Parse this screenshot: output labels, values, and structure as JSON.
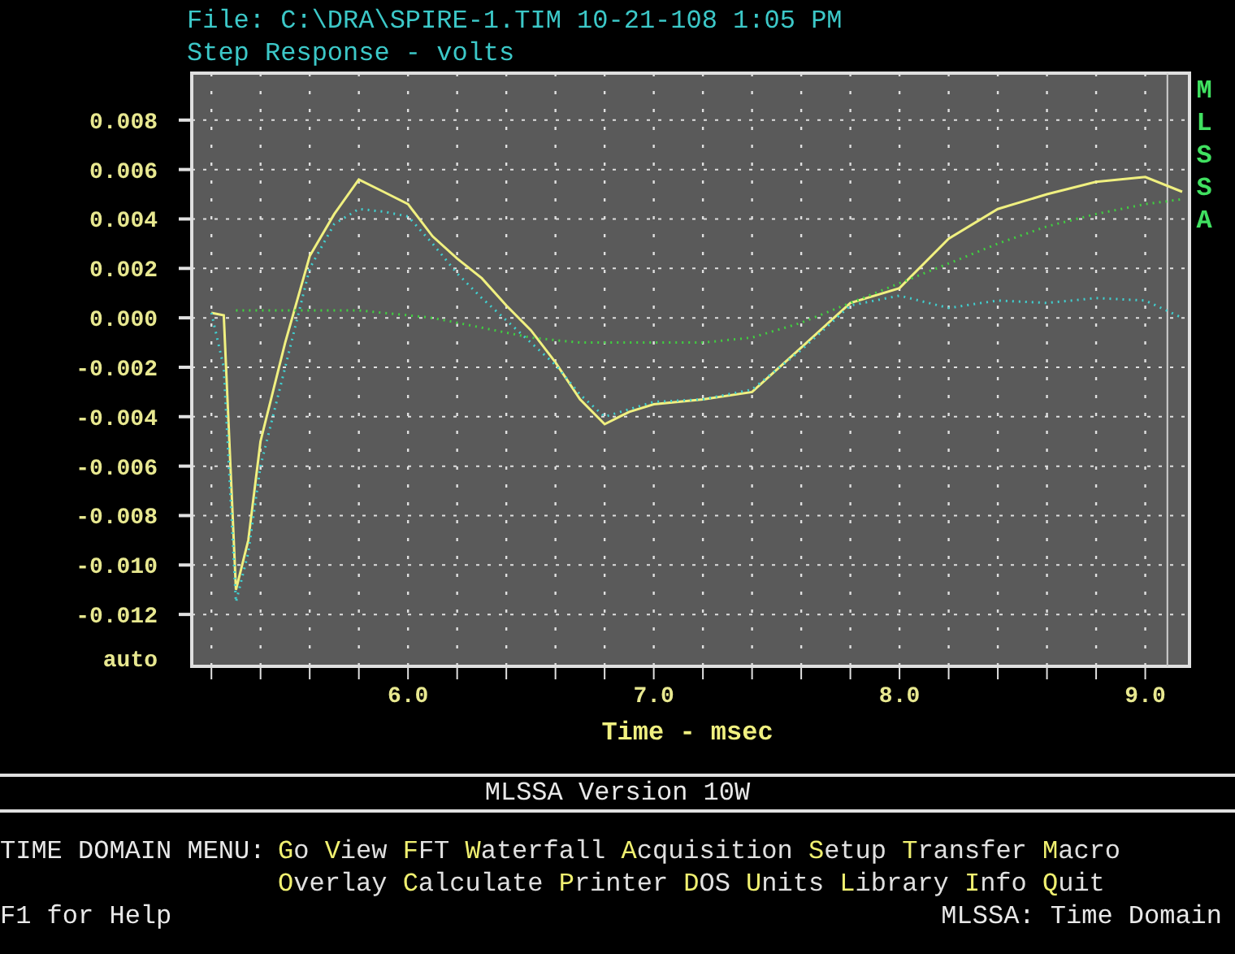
{
  "header": {
    "file_line": "File: C:\\DRA\\SPIRE-1.TIM 10-21-108 1:05 PM",
    "subtitle": "Step Response - volts"
  },
  "chart": {
    "side_label": "MLSSA",
    "scale_label": "auto",
    "chart_data": {
      "type": "line",
      "grid": true,
      "ref_lines": [
        {
          "axis": "x",
          "value": 9.09
        }
      ],
      "xlabel": "Time - msec",
      "xlim": [
        5.12,
        9.18
      ],
      "ylim": [
        -0.0141,
        0.0099
      ],
      "xticks": [
        {
          "value": 6,
          "label": "6.0"
        },
        {
          "value": 7,
          "label": "7.0"
        },
        {
          "value": 8,
          "label": "8.0"
        },
        {
          "value": 9,
          "label": "9.0"
        }
      ],
      "yticks": [
        {
          "value": 0.008,
          "label": "0.008"
        },
        {
          "value": 0.006,
          "label": "0.006"
        },
        {
          "value": 0.004,
          "label": "0.004"
        },
        {
          "value": 0.002,
          "label": "0.002"
        },
        {
          "value": 0,
          "label": "0.000"
        },
        {
          "value": -0.002,
          "label": "-0.002"
        },
        {
          "value": -0.004,
          "label": "-0.004"
        },
        {
          "value": -0.006,
          "label": "-0.006"
        },
        {
          "value": -0.008,
          "label": "-0.008"
        },
        {
          "value": -0.01,
          "label": "-0.010"
        },
        {
          "value": -0.012,
          "label": "-0.012"
        }
      ],
      "x": [
        5.2,
        5.25,
        5.3,
        5.35,
        5.4,
        5.5,
        5.6,
        5.7,
        5.8,
        5.9,
        6.0,
        6.1,
        6.2,
        6.3,
        6.4,
        6.5,
        6.6,
        6.7,
        6.8,
        6.9,
        7.0,
        7.2,
        7.4,
        7.6,
        7.8,
        8.0,
        8.2,
        8.4,
        8.6,
        8.8,
        9.0,
        9.15
      ],
      "series": [
        {
          "line_style": "solid",
          "color": "#f0f080",
          "values": [
            0.0002,
            0.0001,
            -0.011,
            -0.009,
            -0.005,
            -0.001,
            0.0025,
            0.0042,
            0.0056,
            0.0051,
            0.0046,
            0.0033,
            0.0024,
            0.0016,
            0.0005,
            -0.0005,
            -0.0018,
            -0.0033,
            -0.0043,
            -0.0038,
            -0.0035,
            -0.0033,
            -0.003,
            -0.0012,
            0.0006,
            0.0012,
            0.0032,
            0.0044,
            0.005,
            0.0055,
            0.0057,
            0.0051
          ]
        },
        {
          "line_style": "dotted",
          "color": "#40d0d0",
          "values": [
            0.0002,
            -0.002,
            -0.0115,
            -0.0095,
            -0.006,
            -0.002,
            0.002,
            0.0038,
            0.0044,
            0.0043,
            0.0041,
            0.003,
            0.0018,
            0.0008,
            -0.0001,
            -0.001,
            -0.0019,
            -0.0031,
            -0.004,
            -0.0037,
            -0.0034,
            -0.0033,
            -0.0029,
            -0.0013,
            0.0005,
            0.0009,
            0.0004,
            0.0007,
            0.0006,
            0.0008,
            0.0007,
            0.0
          ]
        },
        {
          "line_style": "dotted",
          "color": "#40d040",
          "values": [
            null,
            null,
            0.0003,
            0.0003,
            0.0003,
            0.0003,
            0.0003,
            0.0003,
            0.0003,
            0.0002,
            0.0001,
            0.0,
            -0.0002,
            -0.0004,
            -0.0006,
            -0.0008,
            -0.0009,
            -0.001,
            -0.001,
            -0.001,
            -0.001,
            -0.001,
            -0.0008,
            -0.0002,
            0.0006,
            0.0014,
            0.0022,
            0.003,
            0.0037,
            0.0042,
            0.0046,
            0.0048
          ]
        }
      ]
    }
  },
  "version_bar": "MLSSA Version 10W",
  "menu": {
    "label": "TIME DOMAIN MENU:",
    "rows": [
      {
        "items": [
          {
            "hotkey": "G",
            "rest": "o"
          },
          {
            "hotkey": "V",
            "rest": "iew"
          },
          {
            "hotkey": "F",
            "rest": "FT"
          },
          {
            "hotkey": "W",
            "rest": "aterfall"
          },
          {
            "hotkey": "A",
            "rest": "cquisition"
          },
          {
            "hotkey": "S",
            "rest": "etup"
          },
          {
            "hotkey": "T",
            "rest": "ransfer"
          },
          {
            "hotkey": "M",
            "rest": "acro"
          }
        ]
      },
      {
        "items": [
          {
            "hotkey": "O",
            "rest": "verlay"
          },
          {
            "hotkey": "C",
            "rest": "alculate"
          },
          {
            "hotkey": "P",
            "rest": "rinter"
          },
          {
            "hotkey": "D",
            "rest": "OS"
          },
          {
            "hotkey": "U",
            "rest": "nits"
          },
          {
            "hotkey": "L",
            "rest": "ibrary"
          },
          {
            "hotkey": "I",
            "rest": "nfo"
          },
          {
            "hotkey": "Q",
            "rest": "uit"
          }
        ]
      }
    ]
  },
  "status_bar": {
    "left": "F1 for Help",
    "right": "MLSSA: Time Domain"
  }
}
